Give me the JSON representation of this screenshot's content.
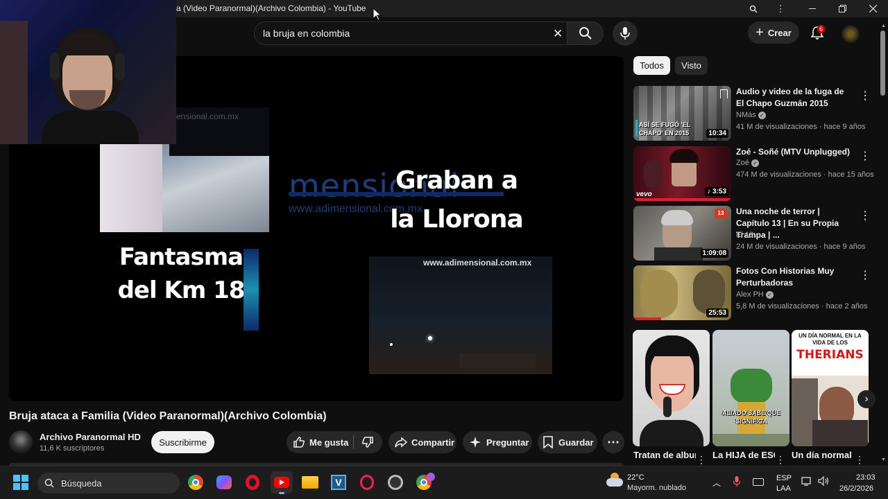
{
  "window": {
    "title": "a (Video Paranormal)(Archivo Colombia) - YouTube"
  },
  "header": {
    "search_value": "la bruja en colombia",
    "create_label": "Crear",
    "notification_count": "6"
  },
  "video": {
    "overlay_text_left": "Fantasma del Km 18",
    "overlay_text_right": "Graban a la Llorona",
    "watermark_1": "www.adimensional.com.mx",
    "watermark_2": "www.adimensional.com.mx",
    "watermark_3": "ensional.com.mx",
    "watermark_logo": "mensional",
    "title": "Bruja ataca a Familia (Video Paranormal)(Archivo Colombia)",
    "channel_name": "Archivo Paranormal HD",
    "subscribers": "11,6 K suscriptores",
    "subscribe_label": "Suscribirme",
    "like_label": "Me gusta",
    "share_label": "Compartir",
    "ask_label": "Preguntar",
    "save_label": "Guardar"
  },
  "chips": {
    "all": "Todos",
    "watched": "Visto"
  },
  "recommendations": [
    {
      "title": "Audio y video de la fuga de El Chapo Guzmán 2015",
      "channel": "NMás",
      "verified": true,
      "meta": "41 M de visualizaciones · hace 9 años",
      "duration": "10:34",
      "thumb_caption": "ASÍ SE FUGÓ 'EL CHAPO' EN 2015"
    },
    {
      "title": "Zoé - Soñé (MTV Unplugged)",
      "channel": "Zoé",
      "verified": true,
      "meta": "474 M de visualizaciones · hace 15 años",
      "duration": "3:53",
      "thumb_caption": "vevo"
    },
    {
      "title": "Una noche de terror | Capítulo 13 | En su Propia Trampa | ...",
      "channel": "El 13",
      "verified": false,
      "meta": "24 M de visualizaciones · hace 9 años",
      "duration": "1:09:08",
      "thumb_caption": "13"
    },
    {
      "title": "Fotos Con Historias Muy Perturbadoras",
      "channel": "Alex PH",
      "verified": true,
      "meta": "5,8 M de visualizaciones · hace 2 años",
      "duration": "25:53",
      "thumb_caption": ""
    }
  ],
  "shorts": [
    {
      "title": "Tratan de alburear a",
      "caption": ""
    },
    {
      "title": "La HIJA de ESCANOR",
      "caption": "ALIADO SABE QUE SIGNIFICA"
    },
    {
      "title": "Un día normal en la",
      "caption_small": "UN DÍA NORMAL EN LA VIDA DE LOS",
      "caption_big": "THERIANS"
    }
  ],
  "taskbar": {
    "search_placeholder": "Búsqueda",
    "temperature": "22°C",
    "weather": "Mayorm. nublado",
    "lang_1": "ESP",
    "lang_2": "LAA",
    "time": "23:03",
    "date": "26/2/2026"
  }
}
